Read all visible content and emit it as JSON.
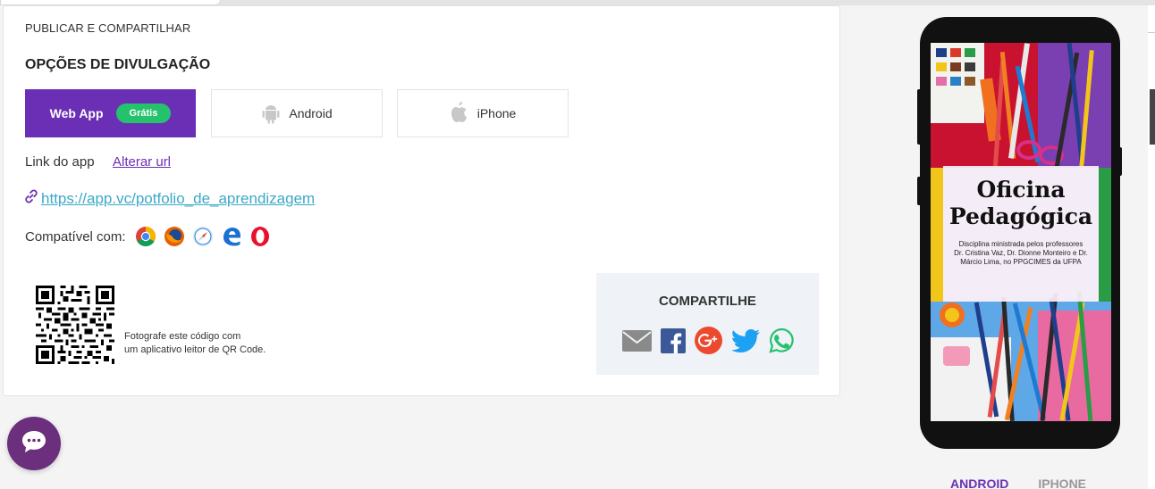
{
  "section": {
    "label": "PUBLICAR E COMPARTILHAR",
    "title": "OPÇÕES DE DIVULGAÇÃO"
  },
  "options": {
    "web_app": "Web App",
    "free_badge": "Grátis",
    "android": "Android",
    "iphone": "iPhone"
  },
  "link": {
    "label": "Link do app",
    "alter_url": "Alterar url",
    "url": " https://app.vc/potfolio_de_aprendizagem"
  },
  "compat": {
    "label": "Compatível com:",
    "browsers": [
      "chrome-icon",
      "firefox-icon",
      "safari-icon",
      "edge-icon",
      "opera-icon"
    ]
  },
  "qr": {
    "line1": "Fotografe este código com",
    "line2": "um aplicativo leitor de QR Code."
  },
  "share": {
    "title": "COMPARTILHE",
    "icons": [
      "email-icon",
      "facebook-icon",
      "google-plus-icon",
      "twitter-icon",
      "whatsapp-icon"
    ]
  },
  "phone": {
    "cover_title_1": "Oficina",
    "cover_title_2": "Pedagógica",
    "cover_sub_1": "Disciplina ministrada pelos professores",
    "cover_sub_2": "Dr. Cristina Vaz, Dr. Dionne Monteiro e Dr.",
    "cover_sub_3": "Márcio Lima, no PPGCIMES da UFPA"
  },
  "preview_tabs": {
    "android": "ANDROID",
    "iphone": "IPHONE"
  },
  "colors": {
    "accent": "#6b2fb5",
    "badge": "#25c26e",
    "link": "#3ba9c9"
  }
}
